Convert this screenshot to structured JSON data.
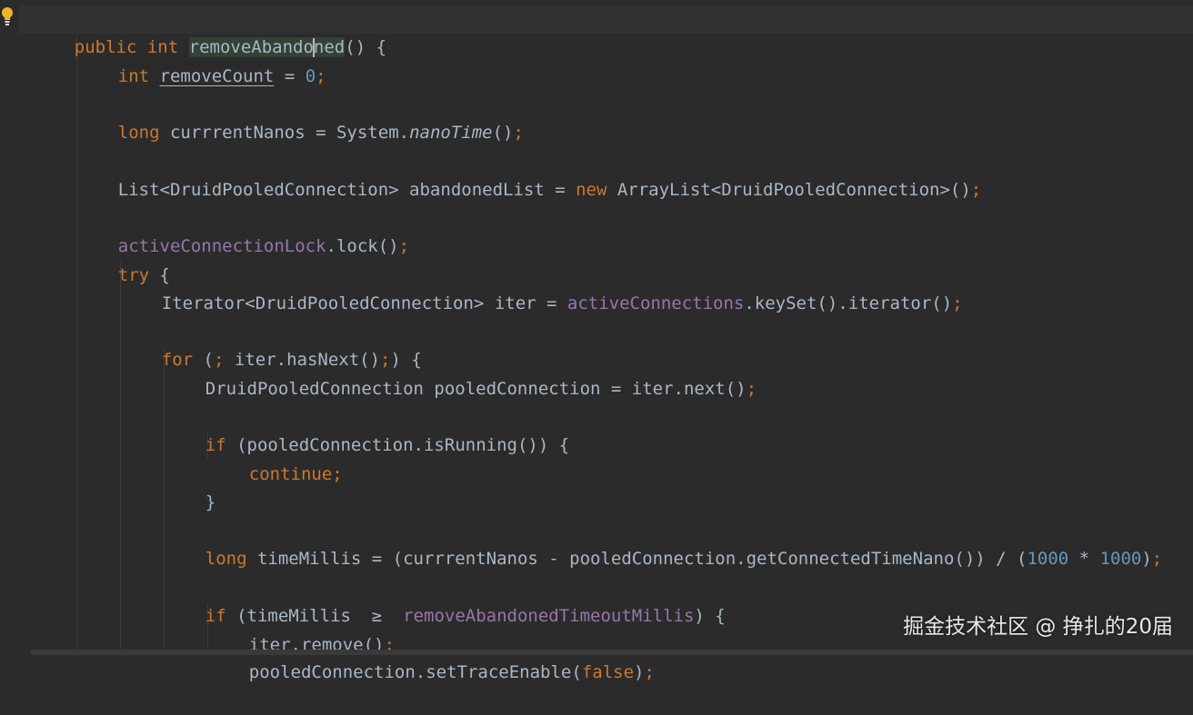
{
  "code": {
    "l1": {
      "a": "public",
      "b": "int",
      "c": "removeAbando",
      "d": "ned",
      "e": "() {"
    },
    "l2": {
      "a": "int",
      "b": "removeCount",
      "c": " = ",
      "d": "0",
      "e": ";"
    },
    "l3": {
      "a": "long",
      "b": " currrentNanos = System.",
      "c": "nanoTime",
      "d": "()",
      "e": ";"
    },
    "l4": {
      "a": "List<DruidPooledConnection> abandonedList = ",
      "b": "new",
      "c": " ArrayList<DruidPooledConnection>()",
      "d": ";"
    },
    "l5": {
      "a": "activeConnectionLock",
      "b": ".lock()",
      "c": ";"
    },
    "l6": {
      "a": "try",
      "b": " {"
    },
    "l7": {
      "a": "Iterator<DruidPooledConnection> iter = ",
      "b": "activeConnections",
      "c": ".keySet().iterator()",
      "d": ";"
    },
    "l8": {
      "a": "for",
      "b": " (",
      "c": ";",
      "d": " iter.hasNext()",
      "e": ";",
      "f": ") {"
    },
    "l9": {
      "a": "DruidPooledConnection pooledConnection = iter.next()",
      "b": ";"
    },
    "l10": {
      "a": "if",
      "b": " (pooledConnection.isRunning()) {"
    },
    "l11": {
      "a": "continue;"
    },
    "l12": {
      "a": "}"
    },
    "l13": {
      "a": "long",
      "b": " timeMillis = (currrentNanos - pooledConnection.getConnectedTimeNano()) / (",
      "c": "1000",
      "d": " * ",
      "e": "1000",
      "f": ")",
      "g": ";"
    },
    "l14": {
      "a": "if",
      "b": " (timeMillis  ≥  ",
      "c": "removeAbandonedTimeoutMillis",
      "d": ") {"
    },
    "l15": {
      "a": "iter.remove()",
      "b": ";"
    },
    "l16": {
      "a": "pooledConnection.setTraceEnable(",
      "b": "false",
      "c": ")",
      "d": ";"
    }
  },
  "watermark": "掘金技术社区 @ 挣扎的20届",
  "colors": {
    "background": "#2b2b2b",
    "keyword": "#cc7832",
    "field": "#9876aa",
    "number": "#6897bb",
    "text": "#a9b7c6"
  }
}
